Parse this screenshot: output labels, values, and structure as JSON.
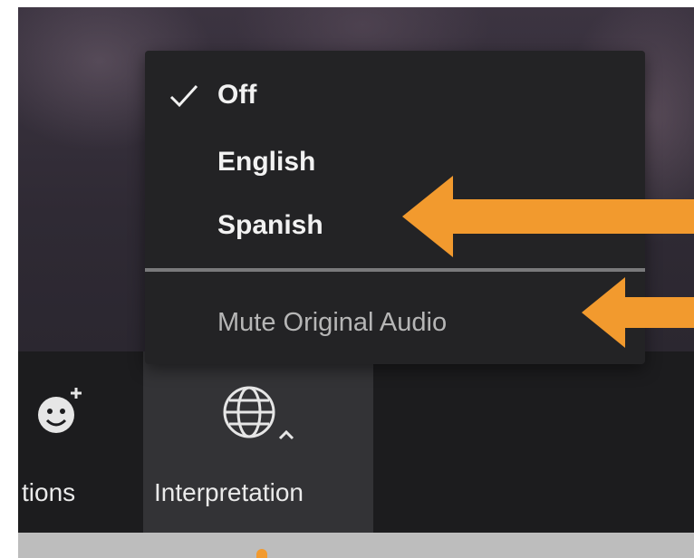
{
  "menu": {
    "items": [
      {
        "label": "Off",
        "checked": true
      },
      {
        "label": "English",
        "checked": false
      },
      {
        "label": "Spanish",
        "checked": false
      }
    ],
    "mute_option": {
      "label": "Mute Original Audio"
    }
  },
  "toolbar": {
    "reactions_label": "tions",
    "interpretation_label": "Interpretation"
  },
  "icons": {
    "check": "checkmark-icon",
    "globe": "globe-icon",
    "smile": "smile-plus-icon",
    "caret": "caret-up-icon"
  },
  "colors": {
    "highlight_arrow": "#f29a2e",
    "menu_bg": "#232325",
    "toolbar_bg": "#1c1c1e",
    "active_button_bg": "#333336"
  }
}
